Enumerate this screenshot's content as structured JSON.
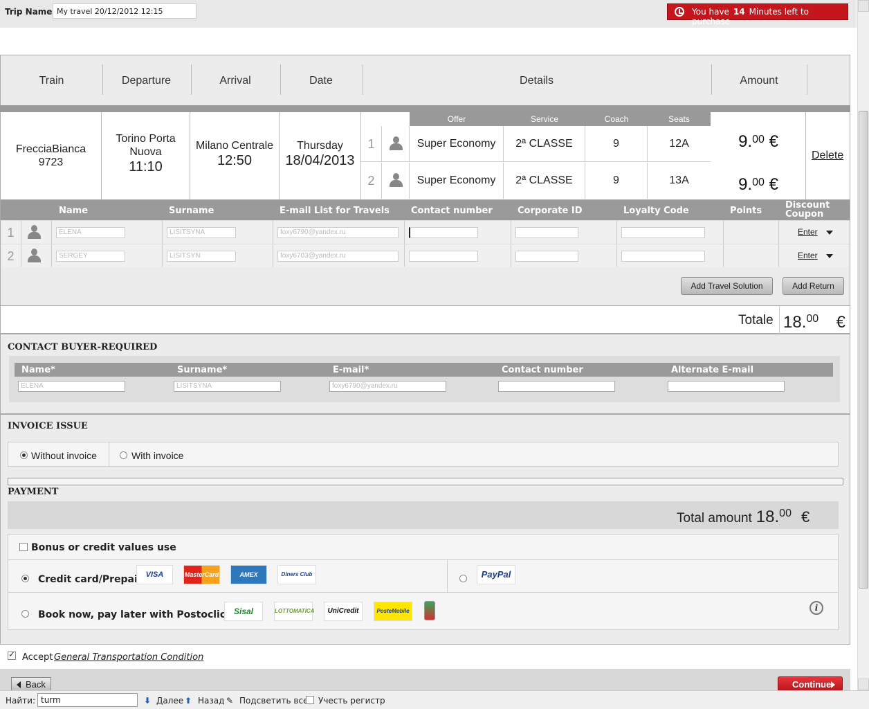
{
  "topbar": {
    "trip_label": "Trip Name",
    "trip_value": "My travel 20/12/2012 12:15",
    "timer_prefix": "You have",
    "timer_minutes": "14",
    "timer_suffix": "Minutes left to purchase"
  },
  "journey_header": {
    "train": "Train",
    "departure": "Departure",
    "arrival": "Arrival",
    "date": "Date",
    "details": "Details",
    "amount": "Amount"
  },
  "train": {
    "name": "FrecciaBianca",
    "number": "9723",
    "dep_station_1": "Torino Porta",
    "dep_station_2": "Nuova",
    "dep_time": "11:10",
    "arr_station": "Milano Centrale",
    "arr_time": "12:50",
    "day": "Thursday",
    "date": "18/04/2013",
    "delete_label": "Delete"
  },
  "details_header": {
    "offer": "Offer",
    "service": "Service",
    "coach": "Coach",
    "seats": "Seats"
  },
  "seats": [
    {
      "num": "1",
      "offer": "Super Economy",
      "service": "2ª CLASSE",
      "coach": "9",
      "seat": "12A",
      "amount_int": "9.",
      "amount_dec": "00",
      "currency": "€"
    },
    {
      "num": "2",
      "offer": "Super Economy",
      "service": "2ª CLASSE",
      "coach": "9",
      "seat": "13A",
      "amount_int": "9.",
      "amount_dec": "00",
      "currency": "€"
    }
  ],
  "passengers_header": {
    "name": "Name",
    "surname": "Surname",
    "email": "E-mail List for Travels",
    "contact": "Contact number",
    "corporate": "Corporate ID",
    "loyalty": "Loyalty Code",
    "points": "Points",
    "discount_1": "Discount",
    "discount_2": "Coupon"
  },
  "passengers": [
    {
      "num": "1",
      "name": "ELENA",
      "surname": "LISITSYNA",
      "email": "foxy6790@yandex.ru",
      "enter": "Enter"
    },
    {
      "num": "2",
      "name": "SERGEY",
      "surname": "LISITSYN",
      "email": "foxy6703@yandex.ru",
      "enter": "Enter"
    }
  ],
  "buttons": {
    "add_travel": "Add Travel Solution",
    "add_return": "Add Return",
    "back": "Back",
    "continue": "Continue"
  },
  "total": {
    "label": "Totale",
    "int": "18.",
    "dec": "00",
    "currency": "€"
  },
  "contact_buyer": {
    "title": "CONTACT BUYER-REQUIRED",
    "name": "Name*",
    "surname": "Surname*",
    "email": "E-mail*",
    "contact": "Contact number",
    "alt_email": "Alternate E-mail",
    "name_val": "ELENA",
    "surname_val": "LISITSYNA",
    "email_val": "foxy6790@yandex.ru"
  },
  "invoice": {
    "title": "INVOICE ISSUE",
    "without": "Without invoice",
    "with": "With invoice"
  },
  "payment": {
    "title": "PAYMENT",
    "total_label": "Total amount",
    "total_int": "18.",
    "total_dec": "00",
    "currency": "€",
    "bonus": "Bonus or credit values use",
    "credit": "Credit card/Prepaid",
    "postoclick": "Book now, pay later with Postoclick"
  },
  "logos": {
    "visa": "VISA",
    "mastercard": "MasterCard",
    "amex": "AMEX",
    "diners": "Diners Club",
    "paypal": "PayPal",
    "sisal": "Sisal",
    "lottomatica": "LOTTOMATICA",
    "unicredit": "UniCredit",
    "postemobile": "PosteMobile"
  },
  "terms": {
    "accept": "Accept",
    "link": "General Transportation Condition"
  },
  "findbar": {
    "find_label": "Найти:",
    "query": "turm",
    "next": "Далее",
    "prev": "Назад",
    "highlight": "Подсветить все",
    "match_case": "Учесть регистр"
  }
}
